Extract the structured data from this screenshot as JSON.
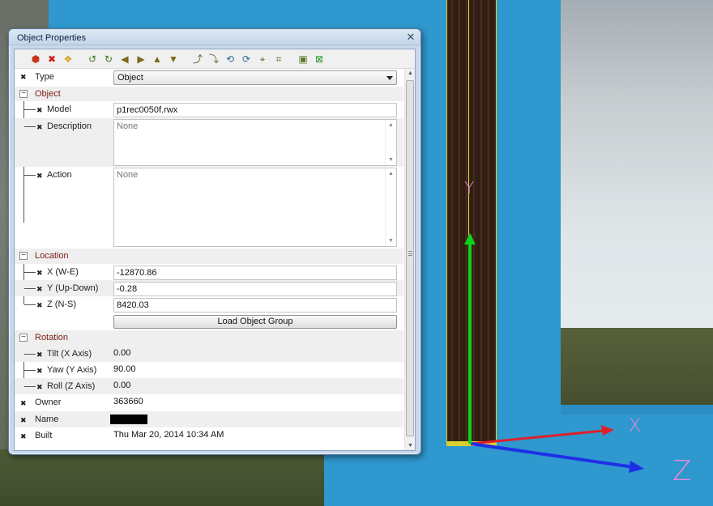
{
  "window": {
    "title": "Object Properties",
    "close_glyph": "✕"
  },
  "toolbar": {
    "buttons": [
      {
        "name": "select-object-icon",
        "glyph": "⬢",
        "color": "#c23a1a"
      },
      {
        "name": "delete-object-icon",
        "glyph": "✖",
        "color": "#d01a1a"
      },
      {
        "name": "duplicate-object-icon",
        "glyph": "❖",
        "color": "#d7a21a"
      },
      {
        "name": "rotate-left-icon",
        "glyph": "↺",
        "color": "#3b7a1c"
      },
      {
        "name": "rotate-right-icon",
        "glyph": "↻",
        "color": "#3b7a1c"
      },
      {
        "name": "move-left-icon",
        "glyph": "◀",
        "color": "#7a6a1c"
      },
      {
        "name": "move-right-icon",
        "glyph": "▶",
        "color": "#7a6a1c"
      },
      {
        "name": "move-up-icon",
        "glyph": "▲",
        "color": "#7a6a1c"
      },
      {
        "name": "move-down-icon",
        "glyph": "▼",
        "color": "#7a6a1c"
      },
      {
        "name": "tilt-forward-icon",
        "glyph": "⤴",
        "color": "#6a5a2a"
      },
      {
        "name": "tilt-back-icon",
        "glyph": "⤵",
        "color": "#6a5a2a"
      },
      {
        "name": "roll-left-icon",
        "glyph": "⟲",
        "color": "#2a6a8a"
      },
      {
        "name": "roll-right-icon",
        "glyph": "⟳",
        "color": "#2a6a8a"
      },
      {
        "name": "snap-icon",
        "glyph": "⌖",
        "color": "#6a5a2a"
      },
      {
        "name": "align-icon",
        "glyph": "⌗",
        "color": "#6a5a2a"
      },
      {
        "name": "group-icon",
        "glyph": "▣",
        "color": "#5a7a2a"
      },
      {
        "name": "ungroup-icon",
        "glyph": "⊠",
        "color": "#2a9a2a"
      }
    ]
  },
  "properties": {
    "type": {
      "label": "Type",
      "value": "Object"
    },
    "object_category": {
      "label": "Object"
    },
    "model": {
      "label": "Model",
      "value": "p1rec0050f.rwx"
    },
    "description": {
      "label": "Description",
      "placeholder": "None"
    },
    "action": {
      "label": "Action",
      "placeholder": "None"
    },
    "location_category": {
      "label": "Location"
    },
    "x": {
      "label": "X (W-E)",
      "value": "-12870.86"
    },
    "y": {
      "label": "Y (Up-Down)",
      "value": "-0.28"
    },
    "z": {
      "label": "Z (N-S)",
      "value": "8420.03"
    },
    "load_group_button": "Load Object Group",
    "rotation_category": {
      "label": "Rotation"
    },
    "tilt": {
      "label": "Tilt (X Axis)",
      "value": "0.00"
    },
    "yaw": {
      "label": "Yaw (Y Axis)",
      "value": "90.00"
    },
    "roll": {
      "label": "Roll (Z Axis)",
      "value": "0.00"
    },
    "owner": {
      "label": "Owner",
      "value": "363660"
    },
    "name": {
      "label": "Name"
    },
    "built": {
      "label": "Built",
      "value": "Thu Mar 20, 2014 10:34 AM"
    }
  },
  "scene": {
    "axis_labels": {
      "x": "X",
      "y": "Y",
      "z": "Z"
    },
    "colors": {
      "x_axis": "#e0202a",
      "y_axis": "#10d21c",
      "z_axis": "#1f2fe6",
      "labels": "#e68ad8",
      "water": "#2f98cf"
    }
  }
}
